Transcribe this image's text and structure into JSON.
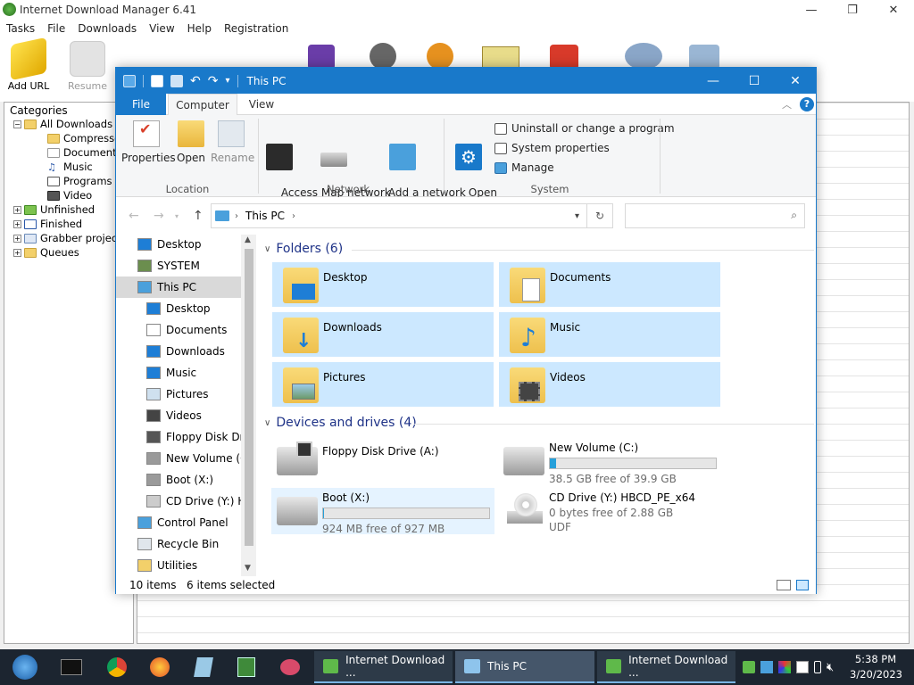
{
  "idm": {
    "title": "Internet Download Manager 6.41",
    "menu": [
      "Tasks",
      "File",
      "Downloads",
      "View",
      "Help",
      "Registration"
    ],
    "toolbar": {
      "add_url": "Add URL",
      "resume": "Resume"
    },
    "categories_label": "Categories",
    "tree": [
      {
        "label": "All Downloads",
        "level": 0
      },
      {
        "label": "Compressed",
        "level": 1
      },
      {
        "label": "Documents",
        "level": 1
      },
      {
        "label": "Music",
        "level": 1
      },
      {
        "label": "Programs",
        "level": 1
      },
      {
        "label": "Video",
        "level": 1
      },
      {
        "label": "Unfinished",
        "level": 0
      },
      {
        "label": "Finished",
        "level": 0
      },
      {
        "label": "Grabber projects",
        "level": 0
      },
      {
        "label": "Queues",
        "level": 0
      }
    ]
  },
  "explorer": {
    "title": "This PC",
    "tabs": {
      "file": "File",
      "computer": "Computer",
      "view": "View"
    },
    "ribbon": {
      "properties": "Properties",
      "open": "Open",
      "rename": "Rename",
      "location_group": "Location",
      "access_media": "Access\nmedia ▾",
      "map_drive": "Map network\ndrive ▾",
      "add_network_location": "Add a network\nlocation",
      "network_group": "Network",
      "open_settings": "Open\nSettings",
      "uninstall": "Uninstall or change a program",
      "system_properties": "System properties",
      "manage": "Manage",
      "system_group": "System"
    },
    "address": {
      "path": "This PC"
    },
    "nav_items": [
      {
        "label": "Desktop",
        "indent": 0
      },
      {
        "label": "SYSTEM",
        "indent": 0
      },
      {
        "label": "This PC",
        "indent": 0
      },
      {
        "label": "Desktop",
        "indent": 1
      },
      {
        "label": "Documents",
        "indent": 1
      },
      {
        "label": "Downloads",
        "indent": 1
      },
      {
        "label": "Music",
        "indent": 1
      },
      {
        "label": "Pictures",
        "indent": 1
      },
      {
        "label": "Videos",
        "indent": 1
      },
      {
        "label": "Floppy Disk Dri",
        "indent": 1
      },
      {
        "label": "New Volume (C",
        "indent": 1
      },
      {
        "label": "Boot (X:)",
        "indent": 1
      },
      {
        "label": "CD Drive (Y:) H",
        "indent": 1
      },
      {
        "label": "Control Panel",
        "indent": 0
      },
      {
        "label": "Recycle Bin",
        "indent": 0
      },
      {
        "label": "Utilities",
        "indent": 0
      }
    ],
    "folders_group": "Folders (6)",
    "folders": [
      "Desktop",
      "Documents",
      "Downloads",
      "Music",
      "Pictures",
      "Videos"
    ],
    "drives_group": "Devices and drives (4)",
    "drives": {
      "floppy": {
        "name": "Floppy Disk Drive (A:)"
      },
      "c": {
        "name": "New Volume (C:)",
        "free": "38.5 GB free of 39.9 GB",
        "used_fraction": 0.035
      },
      "boot": {
        "name": "Boot (X:)",
        "free": "924 MB free of 927 MB",
        "used_fraction": 0.003
      },
      "cd": {
        "name": "CD Drive (Y:) HBCD_PE_x64",
        "free": "0 bytes free of 2.88 GB",
        "fs": "UDF"
      }
    },
    "status": {
      "items": "10 items",
      "selected": "6 items selected"
    }
  },
  "taskbar": {
    "buttons": [
      "Internet Download ...",
      "This PC",
      "Internet Download ..."
    ],
    "time": "5:38 PM",
    "date": "3/20/2023"
  }
}
